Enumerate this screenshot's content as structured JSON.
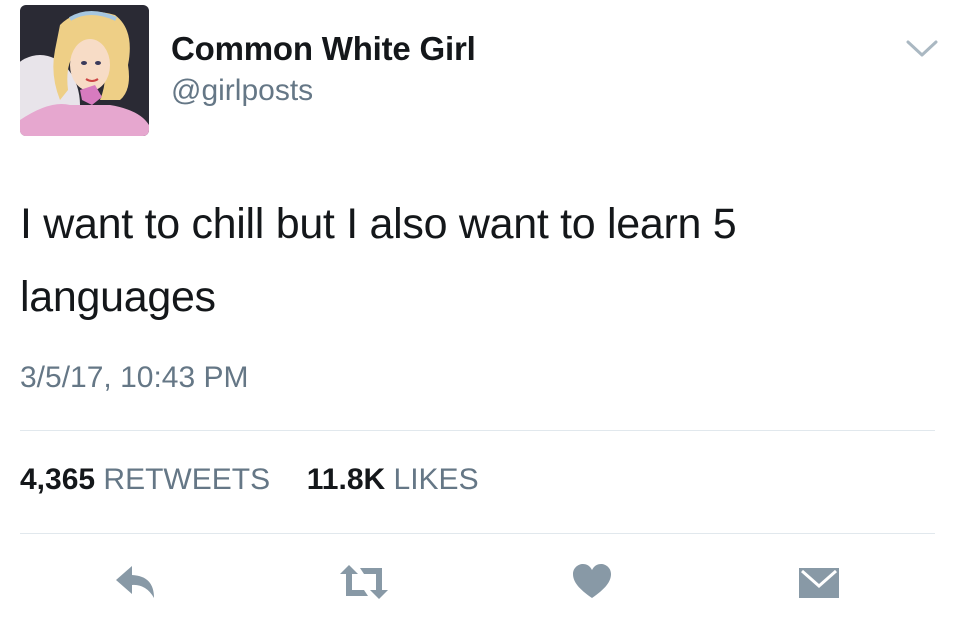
{
  "user": {
    "display_name": "Common White Girl",
    "handle": "@girlposts"
  },
  "tweet": {
    "text": "I want to chill but I also want to learn 5 languages",
    "timestamp": "3/5/17, 10:43 PM"
  },
  "stats": {
    "retweet_count": "4,365",
    "retweet_label": "RETWEETS",
    "like_count": "11.8K",
    "like_label": "LIKES"
  },
  "colors": {
    "text_primary": "#14171a",
    "text_secondary": "#657786",
    "icon": "#8899a6",
    "divider": "#e1e8ed"
  },
  "icons": {
    "menu": "chevron-down-icon",
    "reply": "reply-icon",
    "retweet": "retweet-icon",
    "like": "heart-icon",
    "dm": "envelope-icon"
  }
}
